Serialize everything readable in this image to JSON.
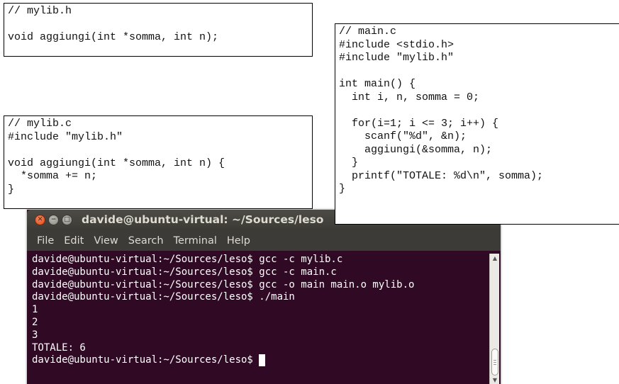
{
  "code_boxes": {
    "mylib_h": {
      "lines": [
        "// mylib.h",
        "",
        "void aggiungi(int *somma, int n);"
      ]
    },
    "mylib_c": {
      "lines": [
        "// mylib.c",
        "#include \"mylib.h\"",
        "",
        "void aggiungi(int *somma, int n) {",
        "  *somma += n;",
        "}"
      ]
    },
    "main_c": {
      "lines": [
        "// main.c",
        "#include <stdio.h>",
        "#include \"mylib.h\"",
        "",
        "int main() {",
        "  int i, n, somma = 0;",
        "",
        "  for(i=1; i <= 3; i++) {",
        "    scanf(\"%d\", &n);",
        "    aggiungi(&somma, n);",
        "  }",
        "  printf(\"TOTALE: %d\\n\", somma);",
        "}"
      ]
    }
  },
  "terminal": {
    "title": "davide@ubuntu-virtual: ~/Sources/leso",
    "window_buttons": [
      "close-icon",
      "minimize-icon",
      "maximize-icon"
    ],
    "menu": [
      "File",
      "Edit",
      "View",
      "Search",
      "Terminal",
      "Help"
    ],
    "lines": [
      "davide@ubuntu-virtual:~/Sources/leso$ gcc -c mylib.c",
      "davide@ubuntu-virtual:~/Sources/leso$ gcc -c main.c",
      "davide@ubuntu-virtual:~/Sources/leso$ gcc -o main main.o mylib.o",
      "davide@ubuntu-virtual:~/Sources/leso$ ./main",
      "1",
      "2",
      "3",
      "TOTALE: 6"
    ],
    "prompt": "davide@ubuntu-virtual:~/Sources/leso$ ",
    "colors": {
      "background": "#300a24",
      "text": "#ffffff",
      "titlebar": "#3c3b37",
      "close_button": "#df4b16"
    }
  }
}
